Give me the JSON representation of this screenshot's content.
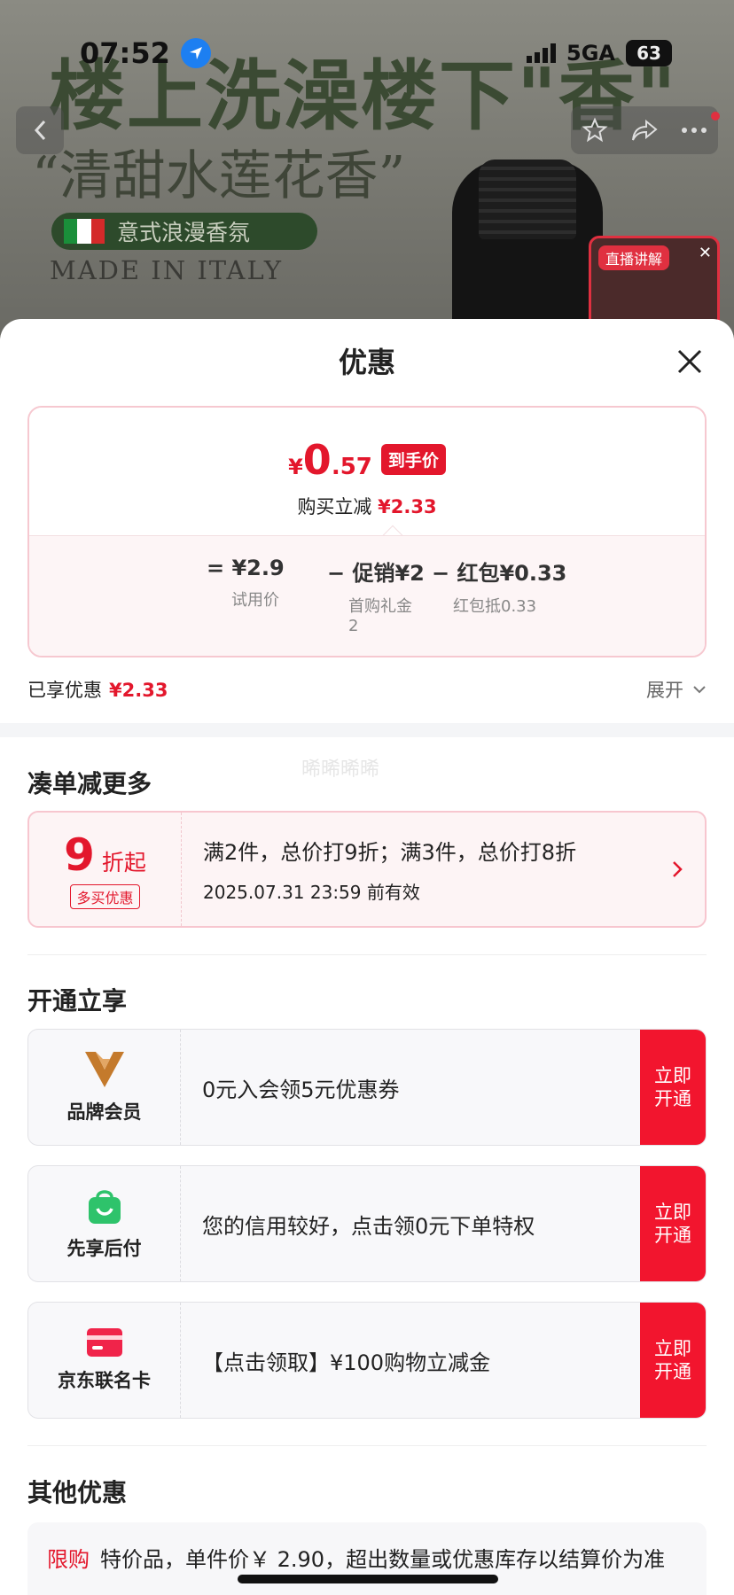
{
  "status_bar": {
    "time": "07:52",
    "network": "5GA",
    "battery": "63"
  },
  "hero": {
    "title": "楼上洗澡楼下\"香\"",
    "subtitle": "“清甜水莲花香”",
    "pill_text": "意式浪漫香氛",
    "made_in": "MADE IN ITALY",
    "live_badge": "直播讲解",
    "flag_colors": [
      "#1a8f3a",
      "#ffffff",
      "#d42a2a"
    ]
  },
  "sheet": {
    "title": "优惠",
    "price_card": {
      "currency": "¥",
      "price_int": "0",
      "price_dec": ".57",
      "tag": "到手价",
      "reduce_label": "购买立减",
      "reduce_value": "¥2.33",
      "formula": [
        {
          "main": "= ¥2.9",
          "sub": "试用价"
        },
        {
          "main": "− 促销¥2",
          "sub": "首购礼金2"
        },
        {
          "main": "− 红包¥0.33",
          "sub": "红包抵0.33"
        }
      ]
    },
    "enjoyed": {
      "label": "已享优惠",
      "value": "¥2.33",
      "expand": "展开"
    },
    "bundle": {
      "title": "凑单减更多",
      "watermark": "晞晞晞晞",
      "discount": "9",
      "discount_unit": "折起",
      "tag": "多买优惠",
      "rule": "满2件，总价打9折；满3件，总价打8折",
      "valid": "2025.07.31 23:59 前有效"
    },
    "open_section": {
      "title": "开通立享",
      "items": [
        {
          "name": "品牌会员",
          "desc": "0元入会领5元优惠券",
          "button": "立即开通",
          "icon": "brand-member-icon"
        },
        {
          "name": "先享后付",
          "desc": "您的信用较好，点击领0元下单特权",
          "button": "立即开通",
          "icon": "pay-later-bag-icon"
        },
        {
          "name": "京东联名卡",
          "desc": "【点击领取】¥100购物立减金",
          "button": "立即开通",
          "icon": "credit-card-icon"
        }
      ]
    },
    "other": {
      "title": "其他优惠",
      "tag": "限购",
      "text": "特价品，单件价￥ 2.90，超出数量或优惠库存以结算价为准"
    }
  },
  "colors": {
    "accent": "#e3172c",
    "button": "#f2152e",
    "member_gold": "#c47a2c",
    "pay_green": "#2ec36b"
  }
}
